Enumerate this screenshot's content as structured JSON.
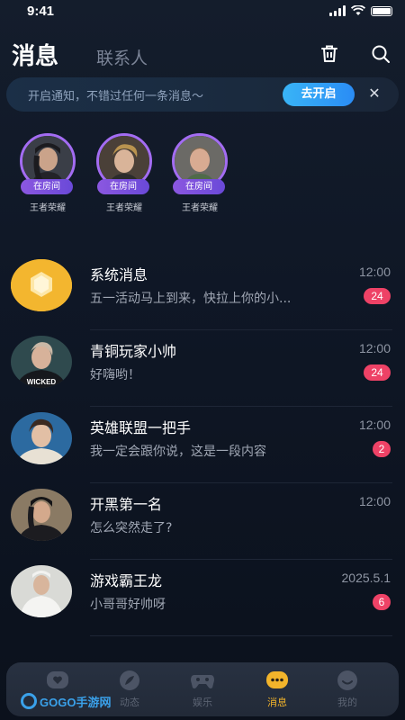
{
  "status_bar": {
    "time": "9:41"
  },
  "header": {
    "tab_messages": "消息",
    "tab_contacts": "联系人",
    "icons": [
      "trash-icon",
      "search-icon"
    ]
  },
  "notice": {
    "text": "开启通知，不错过任何一条消息～",
    "button": "去开启",
    "close": "✕"
  },
  "stories": [
    {
      "badge": "在房间",
      "name": "王者荣耀",
      "ring_color": "#a36cf2"
    },
    {
      "badge": "在房间",
      "name": "王者荣耀",
      "ring_color": "#a36cf2"
    },
    {
      "badge": "在房间",
      "name": "王者荣耀",
      "ring_color": "#a36cf2"
    }
  ],
  "conversations": [
    {
      "name": "系统消息",
      "time": "12:00",
      "message": "五一活动马上到来，快拉上你的小...",
      "unread": "24"
    },
    {
      "name": "青铜玩家小帅",
      "time": "12:00",
      "message": "好嗨哟！",
      "unread": "24",
      "avatar_text": "WICKED"
    },
    {
      "name": "英雄联盟一把手",
      "time": "12:00",
      "message": "我一定会跟你说，这是一段内容",
      "unread": "2"
    },
    {
      "name": "开黑第一名",
      "time": "12:00",
      "message": "怎么突然走了?",
      "unread": ""
    },
    {
      "name": "游戏霸王龙",
      "time": "2025.5.1",
      "message": "小哥哥好帅呀",
      "unread": "6"
    }
  ],
  "bottom_nav": [
    {
      "label": "",
      "icon": "heart-chat-icon"
    },
    {
      "label": "动态",
      "icon": "feather-icon"
    },
    {
      "label": "娱乐",
      "icon": "gamepad-icon"
    },
    {
      "label": "消息",
      "icon": "message-bubble-icon",
      "active": true
    },
    {
      "label": "我的",
      "icon": "smile-icon"
    }
  ],
  "watermark": {
    "text": "GOGO手游网"
  },
  "colors": {
    "accent_blue": "#2a8cf5",
    "badge_red": "#ee4266",
    "nav_active": "#f2b42b",
    "story_ring": "#a36cf2"
  }
}
